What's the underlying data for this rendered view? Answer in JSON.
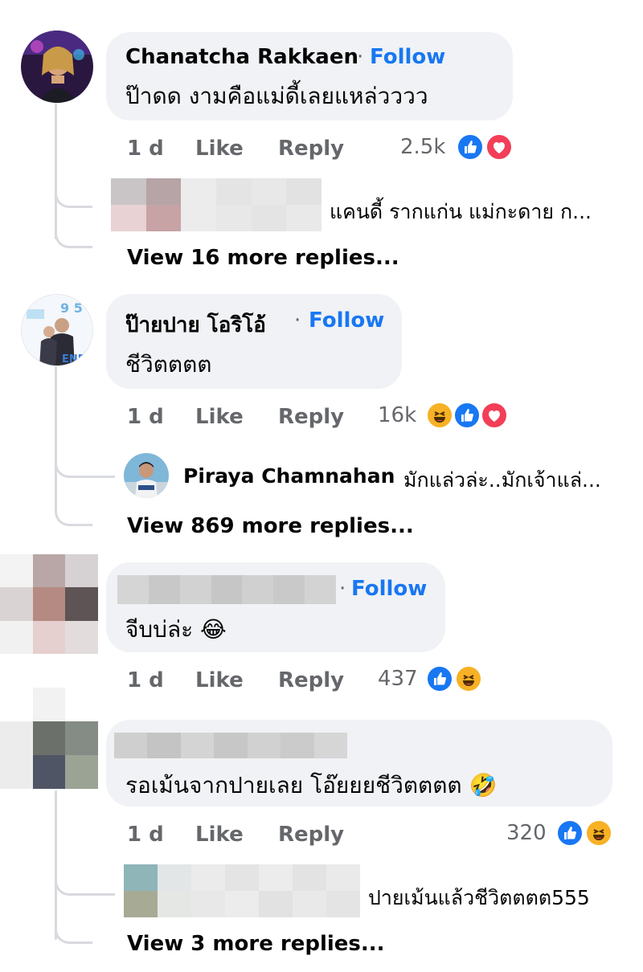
{
  "comments": [
    {
      "name": "Chanatcha Rakkaen",
      "follow": "Follow",
      "text": "ป๊าดด งามคือแม่ดี้เลยแหล่วววว",
      "time": "1 d",
      "like": "Like",
      "reply": "Reply",
      "reaction_count": "2.5k",
      "reactions": [
        "like",
        "love"
      ],
      "reply_preview_text": "แคนดี้ รากแก่น แม่กะดาย ก...",
      "view_more": "View 16 more replies..."
    },
    {
      "name": "ป๊ายปาย โอริโอ้",
      "follow": "Follow",
      "text": "ชีวิตตตต",
      "time": "1 d",
      "like": "Like",
      "reply": "Reply",
      "reaction_count": "16k",
      "reactions": [
        "haha",
        "like",
        "love"
      ],
      "reply_preview_name": "Piraya Chamnahan",
      "reply_preview_text": "มักแล่วล่ะ..มักเจ้าแล่...",
      "view_more": "View 869 more replies..."
    },
    {
      "follow": "Follow",
      "text": "จีบบ่ล่ะ 😂",
      "time": "1 d",
      "like": "Like",
      "reply": "Reply",
      "reaction_count": "437",
      "reactions": [
        "like",
        "haha"
      ]
    },
    {
      "text": "รอเม้นจากปายเลย โอ๊ยยยชีวิตตตต 🤣",
      "time": "1 d",
      "like": "Like",
      "reply": "Reply",
      "reaction_count": "320",
      "reactions": [
        "like",
        "haha"
      ],
      "reply_preview_text": "ปายเม้นแล้วชีวิตตตต555",
      "view_more": "View 3 more replies..."
    }
  ],
  "colors": {
    "follow": "#1877f2",
    "muted": "#65676b",
    "bubble": "#f0f2f5",
    "like": "#1877f2",
    "love": "#f33e58",
    "haha": "#f7b125"
  }
}
